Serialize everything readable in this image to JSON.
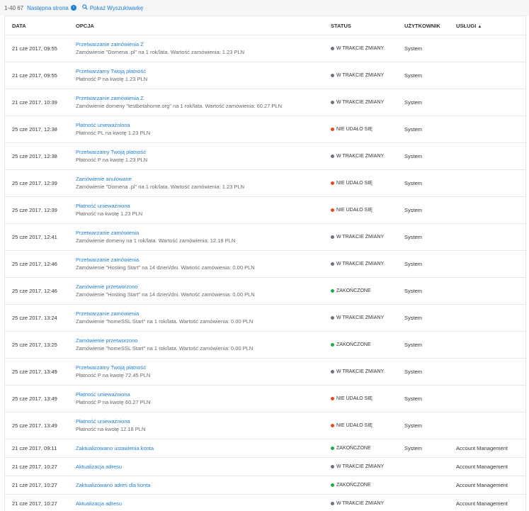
{
  "pager": {
    "count": "1-40 67",
    "next_label": "Następna strona",
    "search_label": "Pokaż Wyszukiwarkę"
  },
  "columns": {
    "date": "DATA",
    "option": "OPCJA",
    "status": "STATUS",
    "user": "UŻYTKOWNIK",
    "services": "USŁUGI"
  },
  "status_colors": {
    "gray": "#6b7280",
    "red": "#e8491d",
    "green": "#23a847"
  },
  "rows": [
    {
      "date": "21 cze 2017, 09:55",
      "link": "Przetwarzanie zamówienia Z",
      "desc": "Zamówienie \"Domena .pl\" na 1 rok/lata. Wartość zamówienia: 1.23 PLN",
      "status": "W TRAKCIE ZMIANY",
      "color": "gray",
      "user": "System",
      "service": ""
    },
    {
      "date": "21 cze 2017, 09:55",
      "link": "Przetwarzamy Twoją płatność",
      "desc": "Płatność P na kwotę 1.23 PLN",
      "status": "W TRAKCIE ZMIANY",
      "color": "gray",
      "user": "System",
      "service": ""
    },
    {
      "date": "21 cze 2017, 10:39",
      "link": "Przetwarzanie zamówienia Z",
      "desc": "Zamówienie domeny \"testbetahome.org\" na 1 rok/lata. Wartość zamówienia: 60.27 PLN",
      "status": "W TRAKCIE ZMIANY",
      "color": "gray",
      "user": "System",
      "service": ""
    },
    {
      "date": "25 cze 2017, 12:38",
      "link": "Płatność unieważniona",
      "desc": "Płatność PL na kwotę 1.23 PLN",
      "status": "NIE UDAŁO SIĘ",
      "color": "red",
      "user": "System",
      "service": ""
    },
    {
      "date": "25 cze 2017, 12:38",
      "link": "Przetwarzamy Twoją płatność",
      "desc": "Płatność P na kwotę 1.23 PLN",
      "status": "W TRAKCIE ZMIANY",
      "color": "gray",
      "user": "System",
      "service": ""
    },
    {
      "date": "25 cze 2017, 12:39",
      "link": "Zamówienie anulowane",
      "desc": "Zamówienie \"Domena .pl\" na 1 rok/lata. Wartość zamówienia: 1.23 PLN",
      "status": "NIE UDAŁO SIĘ",
      "color": "red",
      "user": "System",
      "service": ""
    },
    {
      "date": "25 cze 2017, 12:39",
      "link": "Płatność unieważniona",
      "desc": "Płatność na kwotę 1.23 PLN",
      "status": "NIE UDAŁO SIĘ",
      "color": "red",
      "user": "System",
      "service": ""
    },
    {
      "date": "25 cze 2017, 12:41",
      "link": "Przetwarzanie zamówienia",
      "desc": "Zamówienie domeny na 1 rok/lata. Wartość zamówienia: 12.18 PLN",
      "status": "W TRAKCIE ZMIANY",
      "color": "gray",
      "user": "System",
      "service": ""
    },
    {
      "date": "25 cze 2017, 12:46",
      "link": "Przetwarzanie zamówienia",
      "desc": "Zamówienie \"Hosting Start\" na 14 dzień/dni. Wartość zamówienia: 0.00 PLN",
      "status": "W TRAKCIE ZMIANY",
      "color": "gray",
      "user": "System",
      "service": ""
    },
    {
      "date": "25 cze 2017, 12:46",
      "link": "Zamówienie przetworzono",
      "desc": "Zamówienie \"Hosting Start\" na 14 dzień/dni. Wartość zamówienia: 0.00 PLN",
      "status": "ZAKOŃCZONE",
      "color": "green",
      "user": "System",
      "service": ""
    },
    {
      "date": "25 cze 2017, 13:24",
      "link": "Przetwarzanie zamówienia",
      "desc": "Zamówienie \"homeSSL Start\" na 1 rok/lata. Wartość zamówienia: 0.00 PLN",
      "status": "W TRAKCIE ZMIANY",
      "color": "gray",
      "user": "System",
      "service": ""
    },
    {
      "date": "25 cze 2017, 13:25",
      "link": "Zamówienie przetworzono",
      "desc": "Zamówienie \"homeSSL Start\" na 1 rok/lata. Wartość zamówienia: 0.00 PLN",
      "status": "ZAKOŃCZONE",
      "color": "green",
      "user": "System",
      "service": ""
    },
    {
      "date": "25 cze 2017, 13:49",
      "link": "Przetwarzamy Twoją płatność",
      "desc": "Płatność P na kwotę 72.45 PLN",
      "status": "W TRAKCIE ZMIANY",
      "color": "gray",
      "user": "System",
      "service": ""
    },
    {
      "date": "25 cze 2017, 13:49",
      "link": "Płatność unieważniona",
      "desc": "Płatność P na kwotę 60.27 PLN",
      "status": "NIE UDAŁO SIĘ",
      "color": "red",
      "user": "System",
      "service": ""
    },
    {
      "date": "25 cze 2017, 13:49",
      "link": "Płatność unieważniona",
      "desc": "Płatność na kwotę 12.18 PLN",
      "status": "NIE UDAŁO SIĘ",
      "color": "red",
      "user": "System",
      "service": ""
    },
    {
      "date": "21 cze 2017, 09:11",
      "link": "Zaktualizowano ustawienia konta",
      "desc": "",
      "status": "ZAKOŃCZONE",
      "color": "green",
      "user": "System",
      "service": "Account Management"
    },
    {
      "date": "21 cze 2017, 10:27",
      "link": "Aktualizacja adresu",
      "desc": "",
      "status": "W TRAKCIE ZMIANY",
      "color": "gray",
      "user": "",
      "service": "Account Management"
    },
    {
      "date": "21 cze 2017, 10:27",
      "link": "Zaktualizowano adres dla konta",
      "desc": "",
      "status": "ZAKOŃCZONE",
      "color": "green",
      "user": "",
      "service": "Account Management"
    },
    {
      "date": "21 cze 2017, 10:27",
      "link": "Aktualizacja adresu",
      "desc": "",
      "status": "W TRAKCIE ZMIANY",
      "color": "gray",
      "user": "",
      "service": "Account Management"
    }
  ]
}
